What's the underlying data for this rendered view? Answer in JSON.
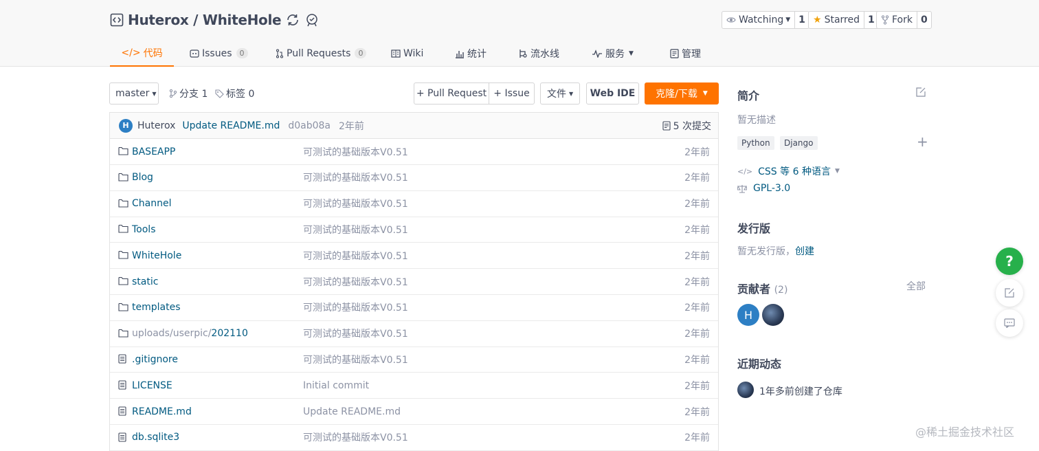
{
  "repo": {
    "title": "Huterox / WhiteHole",
    "watch_label": "Watching",
    "watch_count": "1",
    "star_label": "Starred",
    "star_count": "1",
    "fork_label": "Fork",
    "fork_count": "0"
  },
  "tabs": [
    {
      "label": "代码",
      "icon": "code-icon",
      "active": true
    },
    {
      "label": "Issues",
      "badge": "0",
      "icon": "issues-icon"
    },
    {
      "label": "Pull Requests",
      "badge": "0",
      "icon": "pull-request-icon"
    },
    {
      "label": "Wiki",
      "icon": "wiki-icon"
    },
    {
      "label": "统计",
      "icon": "stats-icon"
    },
    {
      "label": "流水线",
      "icon": "pipeline-icon"
    },
    {
      "label": "服务",
      "icon": "service-icon"
    },
    {
      "label": "管理",
      "icon": "manage-icon"
    }
  ],
  "toolbar": {
    "branch": "master",
    "branches": "分支 1",
    "tags": "标签 0",
    "pull_request": "+ Pull Request",
    "issue": "+ Issue",
    "file_menu": "文件",
    "web_ide": "Web IDE",
    "clone": "克隆/下载"
  },
  "commit": {
    "avatar": "H",
    "author": "Huterox",
    "message": "Update README.md",
    "sha": "d0ab08a",
    "time": "2年前",
    "count": "5 次提交"
  },
  "files": [
    {
      "name": "BASEAPP",
      "type": "folder",
      "message": "可测试的基础版本V0.51",
      "time": "2年前"
    },
    {
      "name": "Blog",
      "type": "folder",
      "message": "可测试的基础版本V0.51",
      "time": "2年前"
    },
    {
      "name": "Channel",
      "type": "folder",
      "message": "可测试的基础版本V0.51",
      "time": "2年前"
    },
    {
      "name": "Tools",
      "type": "folder",
      "message": "可测试的基础版本V0.51",
      "time": "2年前"
    },
    {
      "name": "WhiteHole",
      "type": "folder",
      "message": "可测试的基础版本V0.51",
      "time": "2年前"
    },
    {
      "name": "static",
      "type": "folder",
      "message": "可测试的基础版本V0.51",
      "time": "2年前"
    },
    {
      "name": "templates",
      "type": "folder",
      "message": "可测试的基础版本V0.51",
      "time": "2年前"
    },
    {
      "name": "uploads/userpic/202110",
      "name_prefix": "uploads/userpic/",
      "name_tail": "202110",
      "type": "folder",
      "message": "可测试的基础版本V0.51",
      "time": "2年前"
    },
    {
      "name": ".gitignore",
      "type": "file",
      "message": "可测试的基础版本V0.51",
      "time": "2年前"
    },
    {
      "name": "LICENSE",
      "type": "file",
      "message": "Initial commit",
      "time": "2年前"
    },
    {
      "name": "README.md",
      "type": "file",
      "message": "Update README.md",
      "time": "2年前"
    },
    {
      "name": "db.sqlite3",
      "type": "file",
      "message": "可测试的基础版本V0.51",
      "time": "2年前"
    }
  ],
  "sidebar": {
    "intro_title": "简介",
    "intro_text": "暂无描述",
    "tags": [
      "Python",
      "Django"
    ],
    "languages": "CSS 等 6 种语言",
    "license": "GPL-3.0",
    "release_title": "发行版",
    "release_text": "暂无发行版，",
    "release_link": "创建",
    "contributors_title": "贡献者",
    "contributors_count": "(2)",
    "contributors_all": "全部",
    "contributor_initial": "H",
    "activity_title": "近期动态",
    "activity_text": "1年多前创建了仓库"
  },
  "float": {
    "help": "?"
  },
  "watermark": "@稀土掘金技术社区",
  "colors": {
    "accent": "#fe7300",
    "link": "#005980",
    "muted": "#8c92a4",
    "help_green": "#27b04b"
  }
}
